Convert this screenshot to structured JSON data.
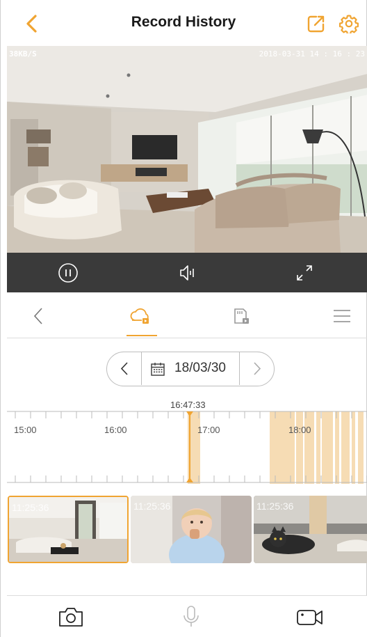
{
  "header": {
    "title": "Record History",
    "accent": "#f0a431"
  },
  "video": {
    "rate": "38KB/S",
    "timestamp": "2018-03-31 14 : 16 : 23"
  },
  "controls": {
    "icons": [
      "pause-icon",
      "volume-icon",
      "fullscreen-icon"
    ]
  },
  "tabs": {
    "icons": [
      "back-icon",
      "cloud-playback-icon",
      "sd-card-playback-icon",
      "menu-icon"
    ],
    "active": "cloud-playback-icon"
  },
  "date_picker": {
    "date": "18/03/30"
  },
  "timeline": {
    "cursor_time": "16:47:33",
    "labels": [
      "15:00",
      "16:00",
      "17:00",
      "18:00"
    ],
    "record_color": "#f6dcb4",
    "cursor_color": "#f0a431"
  },
  "thumbnails": [
    {
      "time": "11:25:36",
      "selected": true,
      "scene": "living room"
    },
    {
      "time": "11:25:36",
      "selected": false,
      "scene": "child"
    },
    {
      "time": "11:25:36",
      "selected": false,
      "scene": "cat"
    }
  ],
  "bottom_bar": {
    "icons": [
      "camera-icon",
      "microphone-icon",
      "video-record-icon"
    ]
  }
}
